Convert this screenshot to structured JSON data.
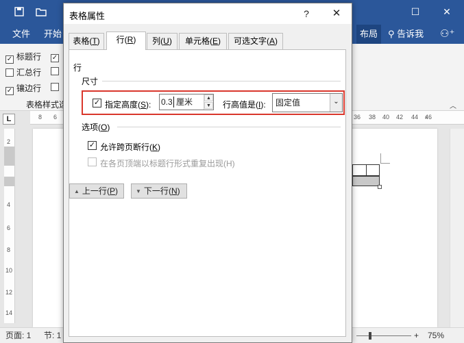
{
  "word": {
    "ribbon_tabs": {
      "file": "文件",
      "home": "开始",
      "layout": "布局",
      "tell_me": "告诉我"
    },
    "style_options": {
      "header_row": "标题行",
      "total_row": "汇总行",
      "banded_rows": "镶边行",
      "group_label": "表格样式选"
    },
    "ruler_top_left": [
      "8",
      "6"
    ],
    "ruler_top_right": [
      "36",
      "38",
      "40",
      "42",
      "44",
      "46"
    ],
    "ruler_left": [
      "2",
      "2",
      "4",
      "6",
      "8",
      "10",
      "12",
      "14"
    ],
    "ruler_corner": "L",
    "status": {
      "page": "页面: 1",
      "section": "节: 1",
      "zoom": "75%"
    }
  },
  "dialog": {
    "title": "表格属性",
    "help": "?",
    "close": "✕",
    "tabs": [
      {
        "label": "表格",
        "key": "T"
      },
      {
        "label": "行",
        "key": "R"
      },
      {
        "label": "列",
        "key": "U"
      },
      {
        "label": "单元格",
        "key": "E"
      },
      {
        "label": "可选文字",
        "key": "A"
      }
    ],
    "row_label": "行",
    "size_label": "尺寸",
    "specify_height": {
      "label": "指定高度",
      "key": "S",
      "checked": true,
      "value": "0.3",
      "unit": "厘米"
    },
    "row_height_is": {
      "label": "行高值是",
      "key": "I",
      "value": "固定值"
    },
    "options_label": "选项",
    "options_key": "O",
    "allow_break": {
      "label": "允许跨页断行",
      "key": "K",
      "checked": true
    },
    "repeat_header": {
      "label": "在各页顶端以标题行形式重复出现(H)",
      "checked": false,
      "enabled": false
    },
    "prev_row": {
      "label": "上一行",
      "key": "P"
    },
    "next_row": {
      "label": "下一行",
      "key": "N"
    }
  },
  "colors": {
    "word_blue": "#2b579a",
    "highlight_red": "#d9362b"
  }
}
